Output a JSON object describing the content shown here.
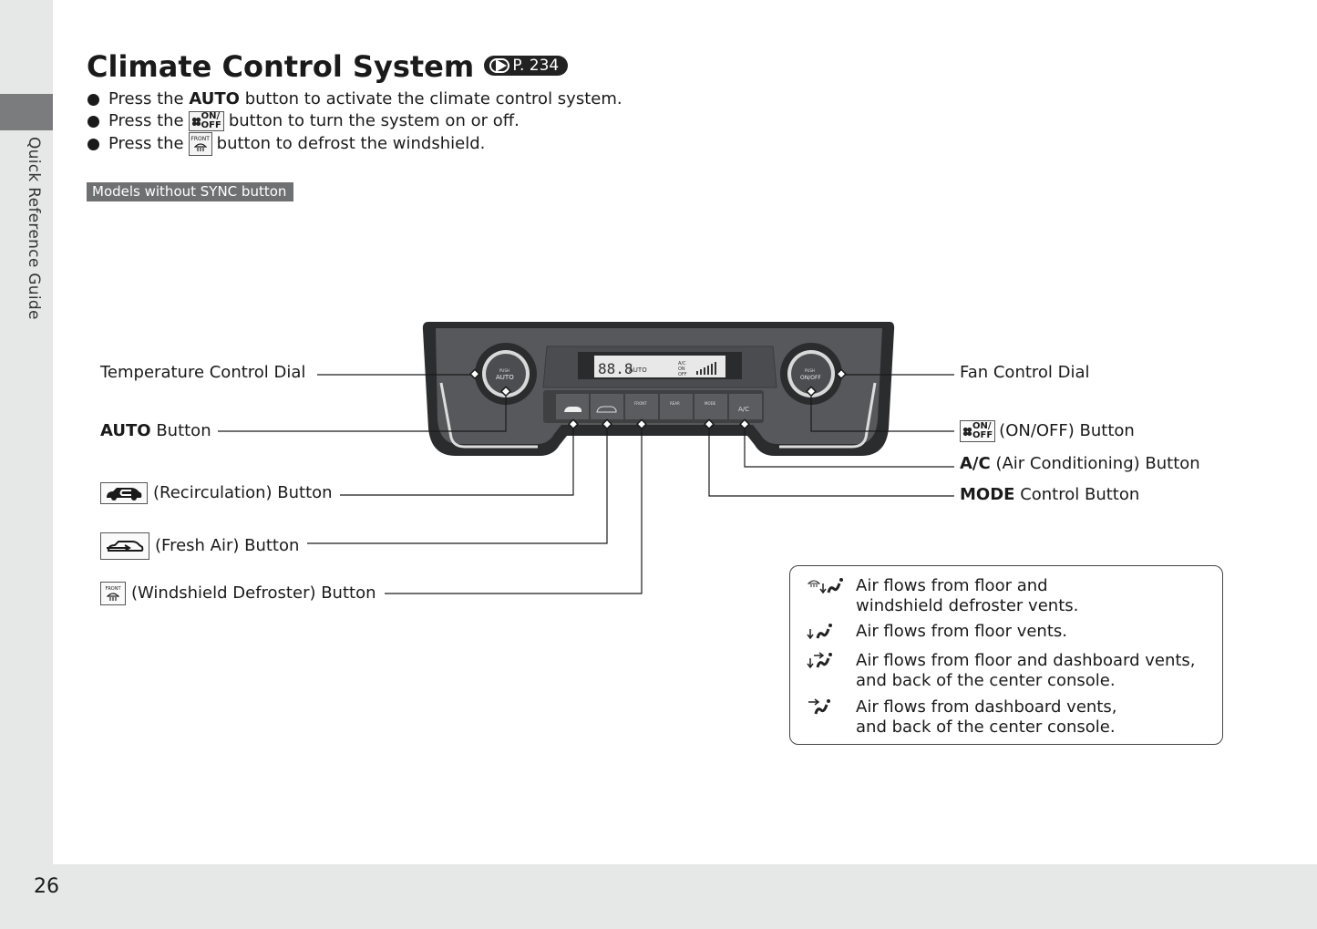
{
  "sidebar": {
    "section_label": "Quick Reference Guide"
  },
  "page": {
    "number": "26"
  },
  "header": {
    "title": "Climate Control System",
    "reference": "P. 234"
  },
  "bullets": [
    {
      "prefix": "Press the",
      "bold": "AUTO",
      "suffix": "button to activate the climate control system."
    },
    {
      "prefix": "Press the",
      "icon": "fan-on-off-icon",
      "icon_text_top": "ON/",
      "icon_text_bottom": "OFF",
      "suffix": "button to turn the system on or off."
    },
    {
      "prefix": "Press the",
      "icon": "front-defrost-icon",
      "icon_text_top": "FRONT",
      "suffix": "button to defrost the windshield."
    }
  ],
  "models_tag": "Models without SYNC button",
  "panel": {
    "left_dial": {
      "top": "PUSH",
      "main": "AUTO"
    },
    "right_dial": {
      "top": "PUSH",
      "main": "ON/OFF"
    },
    "display": {
      "temp": "88.8",
      "auto": "AUTO",
      "ac": "A/C",
      "on": "ON",
      "off": "OFF"
    },
    "buttons": [
      {
        "name": "recirculation",
        "label": ""
      },
      {
        "name": "fresh-air",
        "label": ""
      },
      {
        "name": "front-defrost",
        "label": "FRONT"
      },
      {
        "name": "rear-defrost",
        "label": "REAR"
      },
      {
        "name": "mode",
        "label": "MODE"
      },
      {
        "name": "ac",
        "label": "A/C"
      }
    ]
  },
  "callouts": {
    "temperature_dial": "Temperature Control Dial",
    "auto_bold": "AUTO",
    "auto_rest": "Button",
    "recirculation": "(Recirculation) Button",
    "fresh_air": "(Fresh Air) Button",
    "defroster": "(Windshield Defroster) Button",
    "fan_dial": "Fan Control Dial",
    "on_off": "(ON/OFF) Button",
    "ac_bold": "A/C",
    "ac_rest": "(Air Conditioning) Button",
    "mode_bold": "MODE",
    "mode_rest": "Control Button",
    "on_off_icon_top": "ON/",
    "on_off_icon_bottom": "OFF",
    "front_icon_text": "FRONT"
  },
  "legend": [
    {
      "icon": "floor-defrost-airflow-icon",
      "line1": "Air flows from floor and",
      "line2": "windshield defroster vents."
    },
    {
      "icon": "floor-airflow-icon",
      "line1": "Air flows from floor vents.",
      "line2": ""
    },
    {
      "icon": "floor-dashboard-airflow-icon",
      "line1": "Air flows from floor and dashboard vents,",
      "line2": "and back of the center console."
    },
    {
      "icon": "dashboard-airflow-icon",
      "line1": "Air flows from dashboard vents,",
      "line2": "and back of the center console."
    }
  ],
  "colors": {
    "side_strip": "#e6e7e7",
    "side_tab": "#7b7c7e",
    "models_tag_bg": "#6f7072",
    "panel_body": "#55575a",
    "panel_trim": "#2b2c2e"
  }
}
